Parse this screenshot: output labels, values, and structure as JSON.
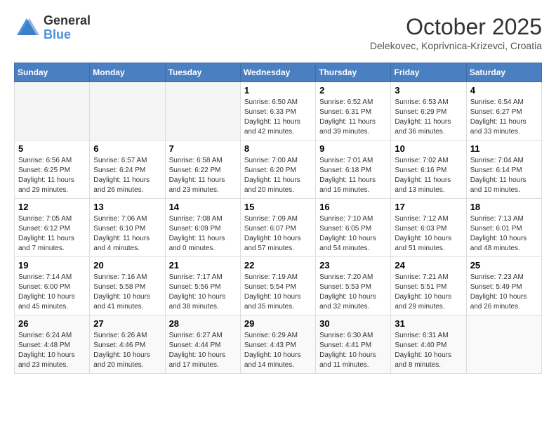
{
  "logo": {
    "general": "General",
    "blue": "Blue"
  },
  "header": {
    "month": "October 2025",
    "location": "Delekovec, Koprivnica-Krizevci, Croatia"
  },
  "weekdays": [
    "Sunday",
    "Monday",
    "Tuesday",
    "Wednesday",
    "Thursday",
    "Friday",
    "Saturday"
  ],
  "weeks": [
    [
      {
        "day": "",
        "info": ""
      },
      {
        "day": "",
        "info": ""
      },
      {
        "day": "",
        "info": ""
      },
      {
        "day": "1",
        "info": "Sunrise: 6:50 AM\nSunset: 6:33 PM\nDaylight: 11 hours\nand 42 minutes."
      },
      {
        "day": "2",
        "info": "Sunrise: 6:52 AM\nSunset: 6:31 PM\nDaylight: 11 hours\nand 39 minutes."
      },
      {
        "day": "3",
        "info": "Sunrise: 6:53 AM\nSunset: 6:29 PM\nDaylight: 11 hours\nand 36 minutes."
      },
      {
        "day": "4",
        "info": "Sunrise: 6:54 AM\nSunset: 6:27 PM\nDaylight: 11 hours\nand 33 minutes."
      }
    ],
    [
      {
        "day": "5",
        "info": "Sunrise: 6:56 AM\nSunset: 6:25 PM\nDaylight: 11 hours\nand 29 minutes."
      },
      {
        "day": "6",
        "info": "Sunrise: 6:57 AM\nSunset: 6:24 PM\nDaylight: 11 hours\nand 26 minutes."
      },
      {
        "day": "7",
        "info": "Sunrise: 6:58 AM\nSunset: 6:22 PM\nDaylight: 11 hours\nand 23 minutes."
      },
      {
        "day": "8",
        "info": "Sunrise: 7:00 AM\nSunset: 6:20 PM\nDaylight: 11 hours\nand 20 minutes."
      },
      {
        "day": "9",
        "info": "Sunrise: 7:01 AM\nSunset: 6:18 PM\nDaylight: 11 hours\nand 16 minutes."
      },
      {
        "day": "10",
        "info": "Sunrise: 7:02 AM\nSunset: 6:16 PM\nDaylight: 11 hours\nand 13 minutes."
      },
      {
        "day": "11",
        "info": "Sunrise: 7:04 AM\nSunset: 6:14 PM\nDaylight: 11 hours\nand 10 minutes."
      }
    ],
    [
      {
        "day": "12",
        "info": "Sunrise: 7:05 AM\nSunset: 6:12 PM\nDaylight: 11 hours\nand 7 minutes."
      },
      {
        "day": "13",
        "info": "Sunrise: 7:06 AM\nSunset: 6:10 PM\nDaylight: 11 hours\nand 4 minutes."
      },
      {
        "day": "14",
        "info": "Sunrise: 7:08 AM\nSunset: 6:09 PM\nDaylight: 11 hours\nand 0 minutes."
      },
      {
        "day": "15",
        "info": "Sunrise: 7:09 AM\nSunset: 6:07 PM\nDaylight: 10 hours\nand 57 minutes."
      },
      {
        "day": "16",
        "info": "Sunrise: 7:10 AM\nSunset: 6:05 PM\nDaylight: 10 hours\nand 54 minutes."
      },
      {
        "day": "17",
        "info": "Sunrise: 7:12 AM\nSunset: 6:03 PM\nDaylight: 10 hours\nand 51 minutes."
      },
      {
        "day": "18",
        "info": "Sunrise: 7:13 AM\nSunset: 6:01 PM\nDaylight: 10 hours\nand 48 minutes."
      }
    ],
    [
      {
        "day": "19",
        "info": "Sunrise: 7:14 AM\nSunset: 6:00 PM\nDaylight: 10 hours\nand 45 minutes."
      },
      {
        "day": "20",
        "info": "Sunrise: 7:16 AM\nSunset: 5:58 PM\nDaylight: 10 hours\nand 41 minutes."
      },
      {
        "day": "21",
        "info": "Sunrise: 7:17 AM\nSunset: 5:56 PM\nDaylight: 10 hours\nand 38 minutes."
      },
      {
        "day": "22",
        "info": "Sunrise: 7:19 AM\nSunset: 5:54 PM\nDaylight: 10 hours\nand 35 minutes."
      },
      {
        "day": "23",
        "info": "Sunrise: 7:20 AM\nSunset: 5:53 PM\nDaylight: 10 hours\nand 32 minutes."
      },
      {
        "day": "24",
        "info": "Sunrise: 7:21 AM\nSunset: 5:51 PM\nDaylight: 10 hours\nand 29 minutes."
      },
      {
        "day": "25",
        "info": "Sunrise: 7:23 AM\nSunset: 5:49 PM\nDaylight: 10 hours\nand 26 minutes."
      }
    ],
    [
      {
        "day": "26",
        "info": "Sunrise: 6:24 AM\nSunset: 4:48 PM\nDaylight: 10 hours\nand 23 minutes."
      },
      {
        "day": "27",
        "info": "Sunrise: 6:26 AM\nSunset: 4:46 PM\nDaylight: 10 hours\nand 20 minutes."
      },
      {
        "day": "28",
        "info": "Sunrise: 6:27 AM\nSunset: 4:44 PM\nDaylight: 10 hours\nand 17 minutes."
      },
      {
        "day": "29",
        "info": "Sunrise: 6:29 AM\nSunset: 4:43 PM\nDaylight: 10 hours\nand 14 minutes."
      },
      {
        "day": "30",
        "info": "Sunrise: 6:30 AM\nSunset: 4:41 PM\nDaylight: 10 hours\nand 11 minutes."
      },
      {
        "day": "31",
        "info": "Sunrise: 6:31 AM\nSunset: 4:40 PM\nDaylight: 10 hours\nand 8 minutes."
      },
      {
        "day": "",
        "info": ""
      }
    ]
  ]
}
